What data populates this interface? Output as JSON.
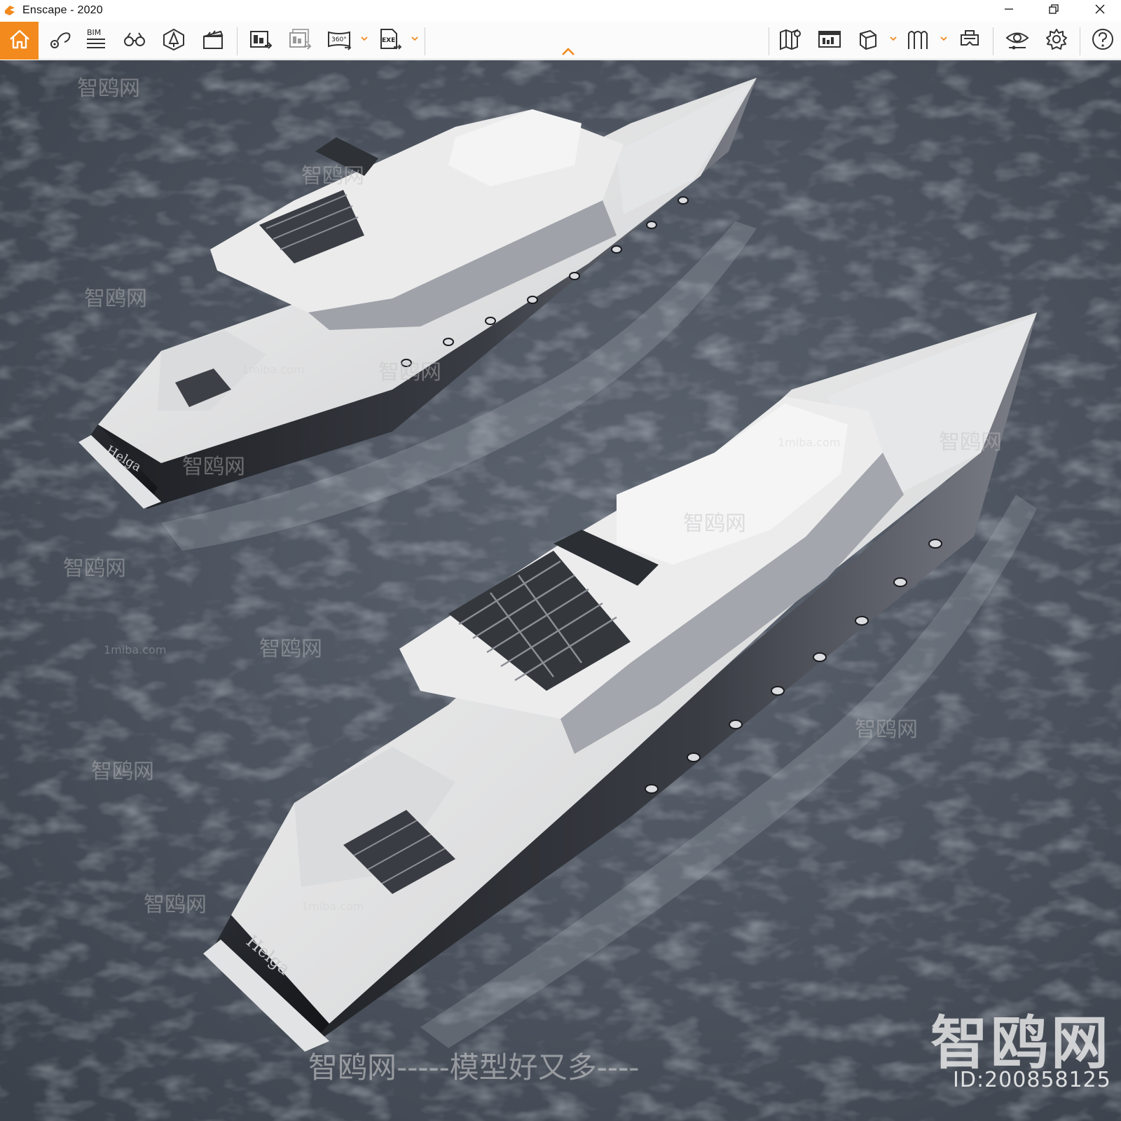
{
  "window": {
    "title": "Enscape - 2020",
    "accent_color": "#f28a1e",
    "controls": [
      "minimize-icon",
      "restore-icon",
      "close-icon"
    ]
  },
  "toolbar": {
    "left_tools": [
      {
        "name": "home-icon",
        "label": ""
      },
      {
        "name": "views-icon",
        "label": ""
      },
      {
        "name": "bim-icon",
        "label": "BIM"
      },
      {
        "name": "binoculars-icon",
        "label": ""
      },
      {
        "name": "asset-library-icon",
        "label": ""
      },
      {
        "name": "video-editor-icon",
        "label": ""
      },
      {
        "name": "screenshot-export-icon",
        "label": ""
      },
      {
        "name": "batch-export-icon",
        "label": ""
      },
      {
        "name": "panorama-export-icon",
        "label": "360°"
      },
      {
        "name": "exe-export-icon",
        "label": "EXE"
      }
    ],
    "right_tools": [
      {
        "name": "map-icon"
      },
      {
        "name": "info-panel-icon"
      },
      {
        "name": "cube-view-icon"
      },
      {
        "name": "sections-icon"
      },
      {
        "name": "vr-headset-icon"
      },
      {
        "name": "visual-settings-icon"
      },
      {
        "name": "settings-gear-icon"
      },
      {
        "name": "help-icon"
      }
    ],
    "collapse_icon": "chevron-up-icon"
  },
  "scene": {
    "yacht_name_1": "Helga",
    "yacht_name_2": "Helga",
    "watermarks": {
      "brand": "智鸥网",
      "slogan": "智鸥网-----模型好又多----",
      "id": "ID:200858125",
      "site": "1miba.com"
    }
  }
}
